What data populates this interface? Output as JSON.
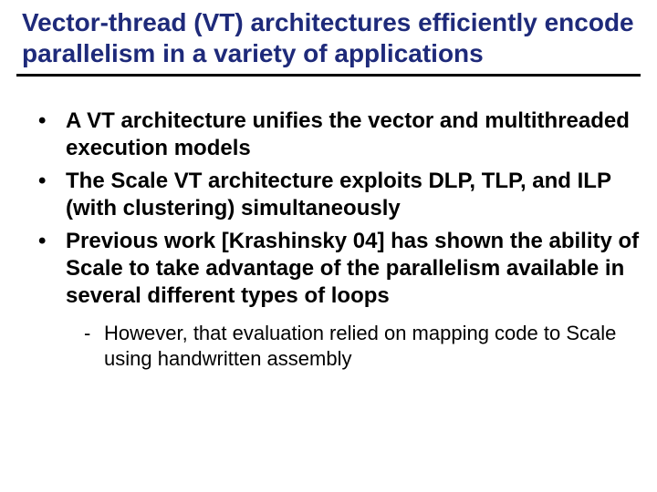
{
  "title": "Vector-thread (VT) architectures efficiently encode parallelism in a variety of applications",
  "bullets": [
    "A VT architecture unifies the vector and multithreaded execution models",
    "The Scale VT architecture exploits DLP, TLP, and ILP (with clustering) simultaneously",
    "Previous work [Krashinsky 04] has shown the ability of Scale to take advantage of the parallelism available in several different types of loops"
  ],
  "sub_bullet": "However, that evaluation relied on mapping code to Scale using handwritten assembly"
}
